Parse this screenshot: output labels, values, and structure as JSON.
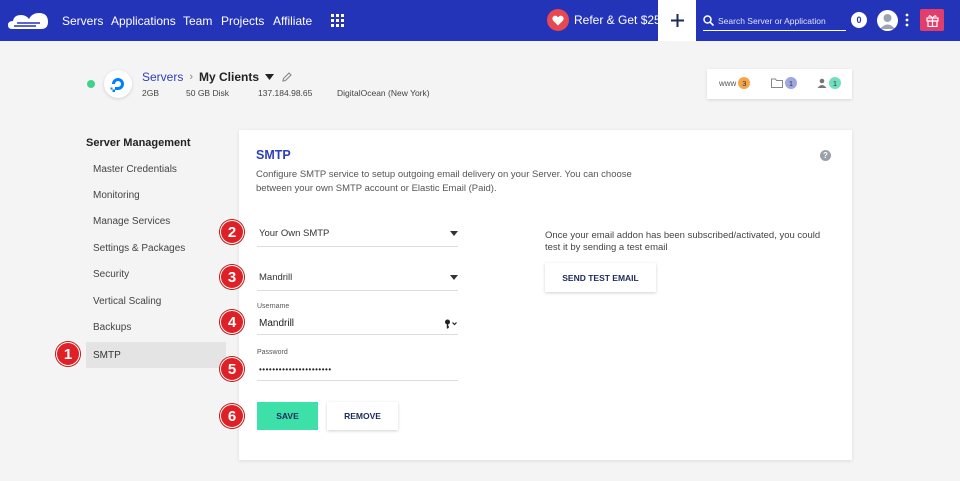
{
  "topbar": {
    "nav": [
      "Servers",
      "Applications",
      "Team",
      "Projects",
      "Affiliate"
    ],
    "refer_label": "Refer & Get $25",
    "plus_label": "+",
    "search_placeholder": "Search Server or Application",
    "notification_count": "0",
    "colors": {
      "bar": "#2434b8",
      "heart": "#e8484f",
      "gift": "#e23e6b"
    }
  },
  "server": {
    "breadcrumb_root": "Servers",
    "breadcrumb_current": "My Clients",
    "ram": "2GB",
    "disk": "50 GB Disk",
    "ip": "137.184.98.65",
    "provider": "DigitalOcean (New York)",
    "status_color": "#3fd28a"
  },
  "stats": {
    "www_label": "www",
    "www_count": "3",
    "folder_count": "1",
    "users_count": "1"
  },
  "sidebar": {
    "title": "Server Management",
    "items": [
      "Master Credentials",
      "Monitoring",
      "Manage Services",
      "Settings & Packages",
      "Security",
      "Vertical Scaling",
      "Backups",
      "SMTP"
    ],
    "active_item": "SMTP"
  },
  "smtp": {
    "title": "SMTP",
    "description": "Configure SMTP service to setup outgoing email delivery on your Server. You can choose between your own SMTP account or Elastic Email (Paid).",
    "smtp_type": "Your Own SMTP",
    "provider": "Mandrill",
    "username_label": "Username",
    "username_value": "Mandrill",
    "password_label": "Password",
    "password_value": "••••••••••••••••••••••",
    "save_label": "SAVE",
    "remove_label": "REMOVE",
    "test_note": "Once your email addon has been subscribed/activated, you could test it by sending a test email",
    "test_button_label": "SEND TEST EMAIL",
    "save_color": "#3de0a8"
  },
  "markers": [
    "1",
    "2",
    "3",
    "4",
    "5",
    "6"
  ]
}
